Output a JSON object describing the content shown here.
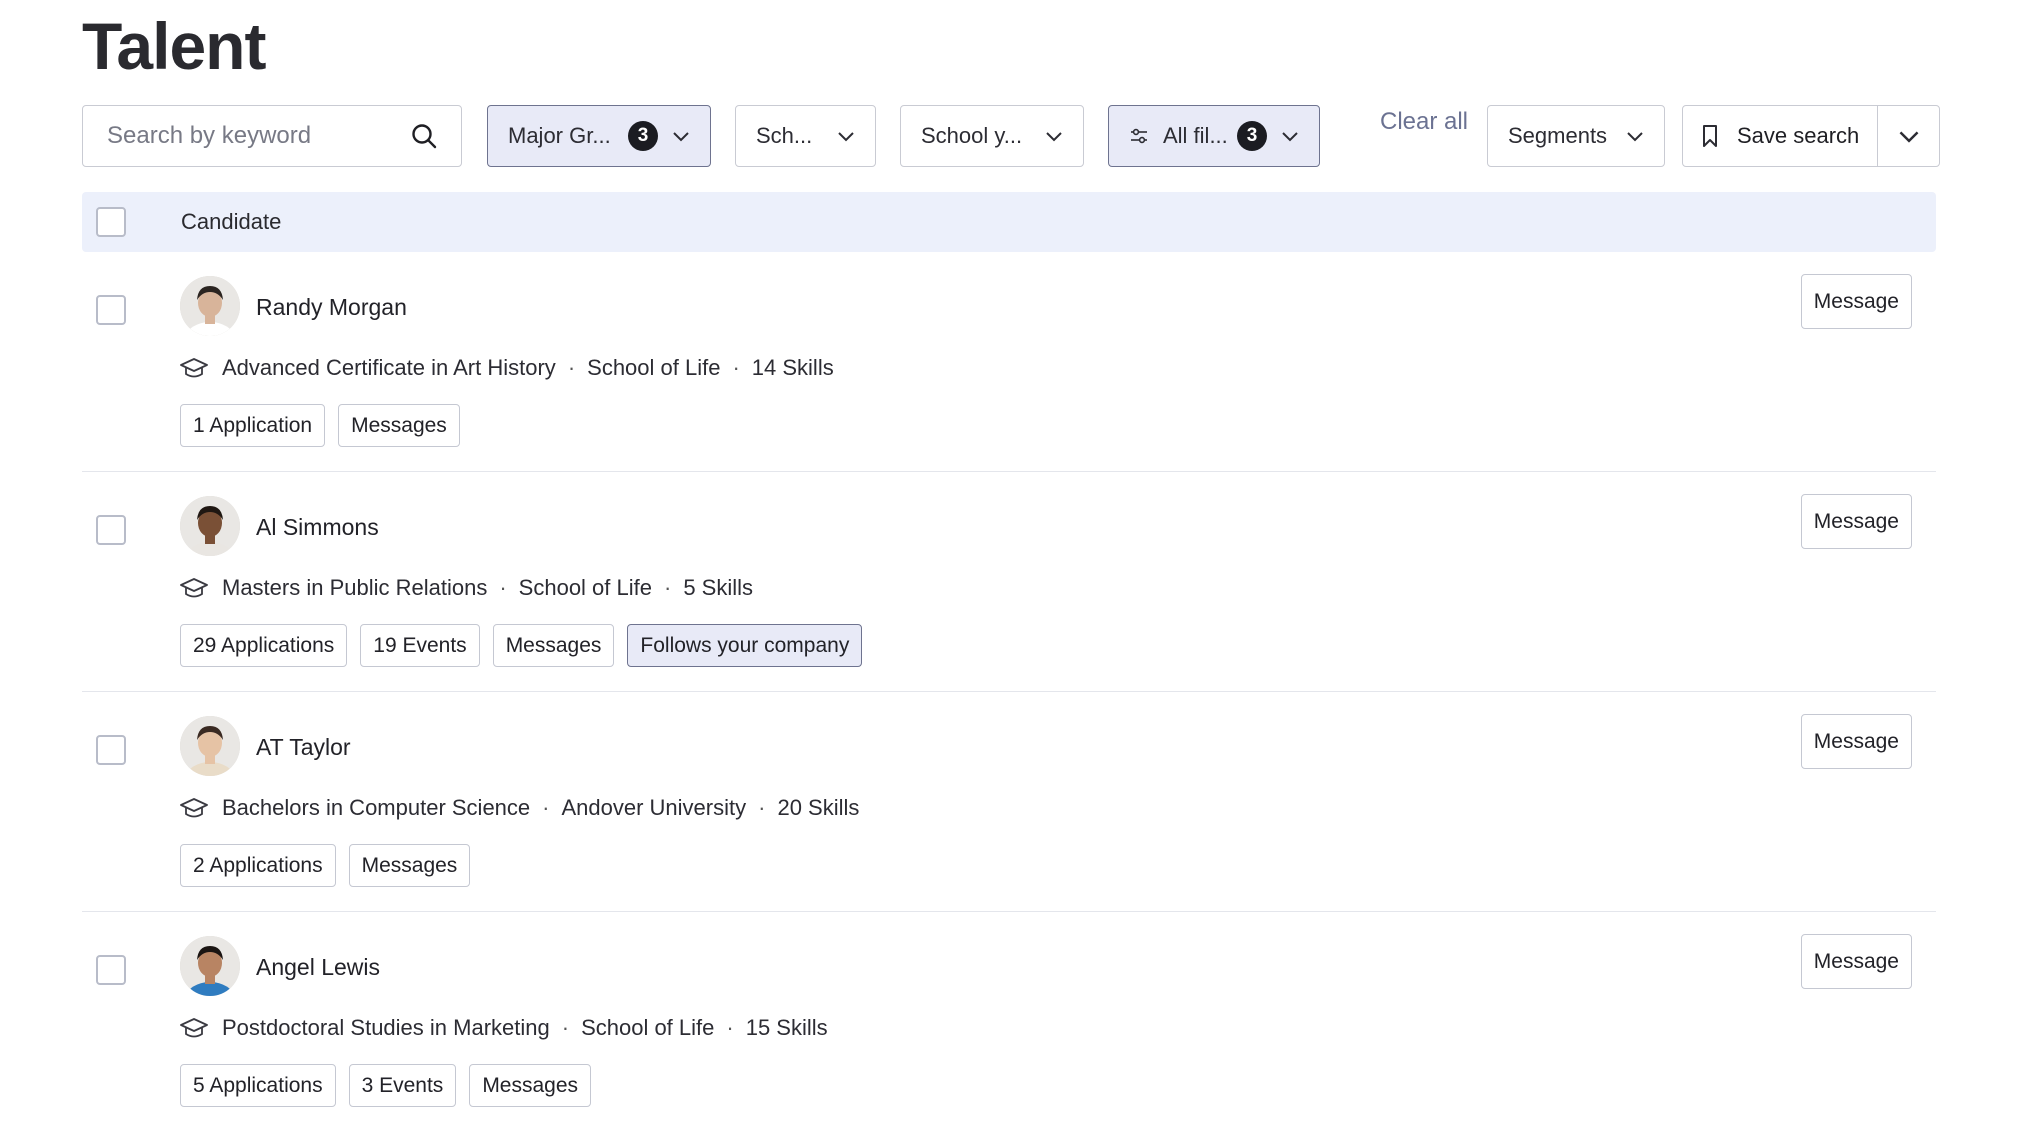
{
  "page": {
    "title": "Talent"
  },
  "toolbar": {
    "search_placeholder": "Search by keyword",
    "filters": [
      {
        "label": "Major Gr...",
        "count": "3",
        "active": true
      },
      {
        "label": "Sch...",
        "count": "",
        "active": false
      },
      {
        "label": "School y...",
        "count": "",
        "active": false
      },
      {
        "label": "All fil...",
        "count": "3",
        "active": true
      }
    ],
    "clear_all": "Clear all",
    "segments": "Segments",
    "save_search": "Save search"
  },
  "table": {
    "header": "Candidate",
    "rows": [
      {
        "name": "Randy Morgan",
        "degree": "Advanced Certificate in Art History",
        "school": "School of Life",
        "skills": "14 Skills",
        "tags": [
          "1 Application",
          "Messages"
        ],
        "highlight_tags": [],
        "action": "Message",
        "avatar_skin": "#d8b49a",
        "avatar_hair": "#2b2420",
        "avatar_shirt": "#ffffff"
      },
      {
        "name": "Al Simmons",
        "degree": "Masters in Public Relations",
        "school": "School of Life",
        "skills": "5 Skills",
        "tags": [
          "29 Applications",
          "19 Events",
          "Messages"
        ],
        "highlight_tags": [
          "Follows your company"
        ],
        "action": "Message",
        "avatar_skin": "#7a5036",
        "avatar_hair": "#1f1712",
        "avatar_shirt": "#e9e6e2"
      },
      {
        "name": "AT Taylor",
        "degree": "Bachelors in Computer Science",
        "school": "Andover University",
        "skills": "20 Skills",
        "tags": [
          "2 Applications",
          "Messages"
        ],
        "highlight_tags": [],
        "action": "Message",
        "avatar_skin": "#e6c3a5",
        "avatar_hair": "#3a2a22",
        "avatar_shirt": "#e9dcc8"
      },
      {
        "name": "Angel Lewis",
        "degree": "Postdoctoral Studies in Marketing",
        "school": "School of Life",
        "skills": "15 Skills",
        "tags": [
          "5 Applications",
          "3 Events",
          "Messages"
        ],
        "highlight_tags": [],
        "action": "Message",
        "avatar_skin": "#b88463",
        "avatar_hair": "#1a1412",
        "avatar_shirt": "#2f7cc0"
      }
    ]
  }
}
